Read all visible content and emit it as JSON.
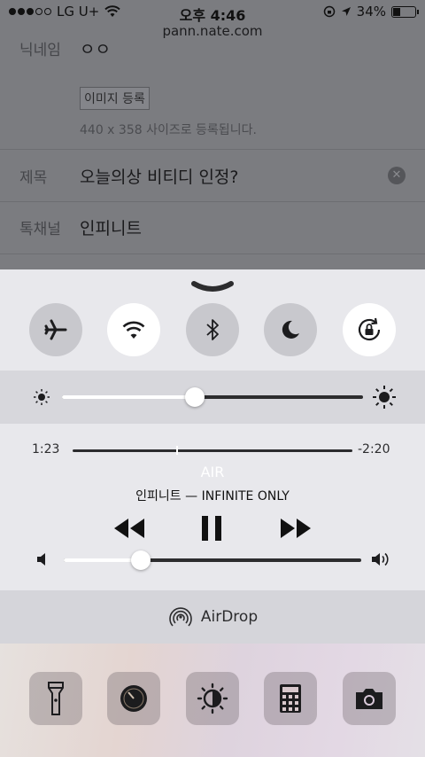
{
  "status_bar": {
    "carrier": "LG U+",
    "time": "오후 4:46",
    "battery": "34%"
  },
  "browser": {
    "url": "pann.nate.com"
  },
  "form": {
    "nickname_label": "닉네임",
    "nickname_value": "ㅇㅇ",
    "image_button": "이미지 등록",
    "image_hint": "440 x 358 사이즈로 등록됩니다.",
    "title_label": "제목",
    "title_value": "오늘의상 비티디 인정?",
    "channel_label": "톡채널",
    "channel_value": "인피니트"
  },
  "control_center": {
    "toggles": [
      {
        "name": "airplane-mode",
        "icon": "airplane-icon",
        "active": false
      },
      {
        "name": "wifi",
        "icon": "wifi-icon",
        "active": true
      },
      {
        "name": "bluetooth",
        "icon": "bluetooth-icon",
        "active": false
      },
      {
        "name": "do-not-disturb",
        "icon": "moon-icon",
        "active": false
      },
      {
        "name": "rotation-lock",
        "icon": "rotation-lock-icon",
        "active": true
      }
    ],
    "brightness_level": 0.44,
    "music": {
      "elapsed": "1:23",
      "remaining": "-2:20",
      "progress": 0.37,
      "track": "AIR",
      "artist_album": "인피니트 — INFINITE ONLY",
      "volume_level": 0.26
    },
    "airdrop_label": "AirDrop",
    "shortcuts": [
      {
        "name": "flashlight",
        "icon": "flashlight-icon"
      },
      {
        "name": "timer",
        "icon": "timer-icon"
      },
      {
        "name": "night-shift",
        "icon": "night-shift-icon"
      },
      {
        "name": "calculator",
        "icon": "calculator-icon"
      },
      {
        "name": "camera",
        "icon": "camera-icon"
      }
    ],
    "colors": {
      "panel_bg": "#e8e8ec",
      "toggle_off": "#c8c8cd",
      "toggle_on": "#ffffff",
      "track_dark": "#2c2c2e"
    }
  }
}
